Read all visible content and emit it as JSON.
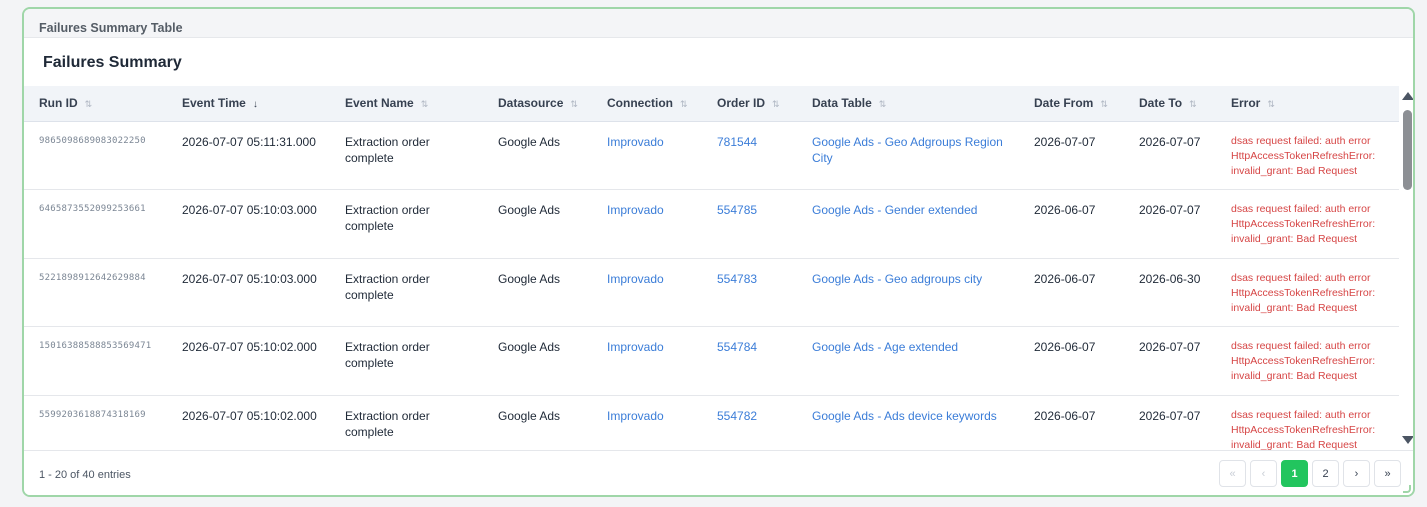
{
  "panel": {
    "title": "Failures Summary Table"
  },
  "section": {
    "title": "Failures Summary"
  },
  "colors": {
    "accent": "#22c55e",
    "link": "#3b7dd8",
    "error": "#d64545",
    "border": "#9fd6a8"
  },
  "table": {
    "columns": [
      {
        "key": "run_id",
        "label": "Run ID",
        "sort": "⇅"
      },
      {
        "key": "event_time",
        "label": "Event Time",
        "sort": "↓"
      },
      {
        "key": "event_name",
        "label": "Event Name",
        "sort": "⇅"
      },
      {
        "key": "datasource",
        "label": "Datasource",
        "sort": "⇅"
      },
      {
        "key": "connection",
        "label": "Connection",
        "sort": "⇅"
      },
      {
        "key": "order_id",
        "label": "Order ID",
        "sort": "⇅"
      },
      {
        "key": "data_table",
        "label": "Data Table",
        "sort": "⇅"
      },
      {
        "key": "date_from",
        "label": "Date From",
        "sort": "⇅"
      },
      {
        "key": "date_to",
        "label": "Date To",
        "sort": "⇅"
      },
      {
        "key": "error",
        "label": "Error",
        "sort": "⇅"
      }
    ],
    "rows": [
      {
        "run_id": "9865098689083022250",
        "event_time": "2026-07-07 05:11:31.000",
        "event_name": "Extraction order complete",
        "datasource": "Google Ads",
        "connection": "Improvado",
        "order_id": "781544",
        "data_table": "Google Ads - Geo Adgroups Region City",
        "date_from": "2026-07-07",
        "date_to": "2026-07-07",
        "error": [
          "dsas request failed: auth error",
          "HttpAccessTokenRefreshError:",
          "invalid_grant: Bad Request"
        ]
      },
      {
        "run_id": "6465873552099253661",
        "event_time": "2026-07-07 05:10:03.000",
        "event_name": "Extraction order complete",
        "datasource": "Google Ads",
        "connection": "Improvado",
        "order_id": "554785",
        "data_table": "Google Ads - Gender extended",
        "date_from": "2026-06-07",
        "date_to": "2026-07-07",
        "error": [
          "dsas request failed: auth error",
          "HttpAccessTokenRefreshError:",
          "invalid_grant: Bad Request"
        ]
      },
      {
        "run_id": "5221898912642629884",
        "event_time": "2026-07-07 05:10:03.000",
        "event_name": "Extraction order complete",
        "datasource": "Google Ads",
        "connection": "Improvado",
        "order_id": "554783",
        "data_table": "Google Ads - Geo adgroups city",
        "date_from": "2026-06-07",
        "date_to": "2026-06-30",
        "error": [
          "dsas request failed: auth error",
          "HttpAccessTokenRefreshError:",
          "invalid_grant: Bad Request"
        ]
      },
      {
        "run_id": "15016388588853569471",
        "event_time": "2026-07-07 05:10:02.000",
        "event_name": "Extraction order complete",
        "datasource": "Google Ads",
        "connection": "Improvado",
        "order_id": "554784",
        "data_table": "Google Ads - Age extended",
        "date_from": "2026-06-07",
        "date_to": "2026-07-07",
        "error": [
          "dsas request failed: auth error",
          "HttpAccessTokenRefreshError:",
          "invalid_grant: Bad Request"
        ]
      },
      {
        "run_id": "5599203618874318169",
        "event_time": "2026-07-07 05:10:02.000",
        "event_name": "Extraction order complete",
        "datasource": "Google Ads",
        "connection": "Improvado",
        "order_id": "554782",
        "data_table": "Google Ads - Ads device keywords",
        "date_from": "2026-06-07",
        "date_to": "2026-07-07",
        "error": [
          "dsas request failed: auth error",
          "HttpAccessTokenRefreshError:",
          "invalid_grant: Bad Request"
        ]
      }
    ]
  },
  "footer": {
    "entries": "1 - 20 of 40 entries",
    "pager": {
      "first": "«",
      "prev": "‹",
      "pages": [
        "1",
        "2"
      ],
      "current": "1",
      "next": "›",
      "last": "»"
    }
  }
}
